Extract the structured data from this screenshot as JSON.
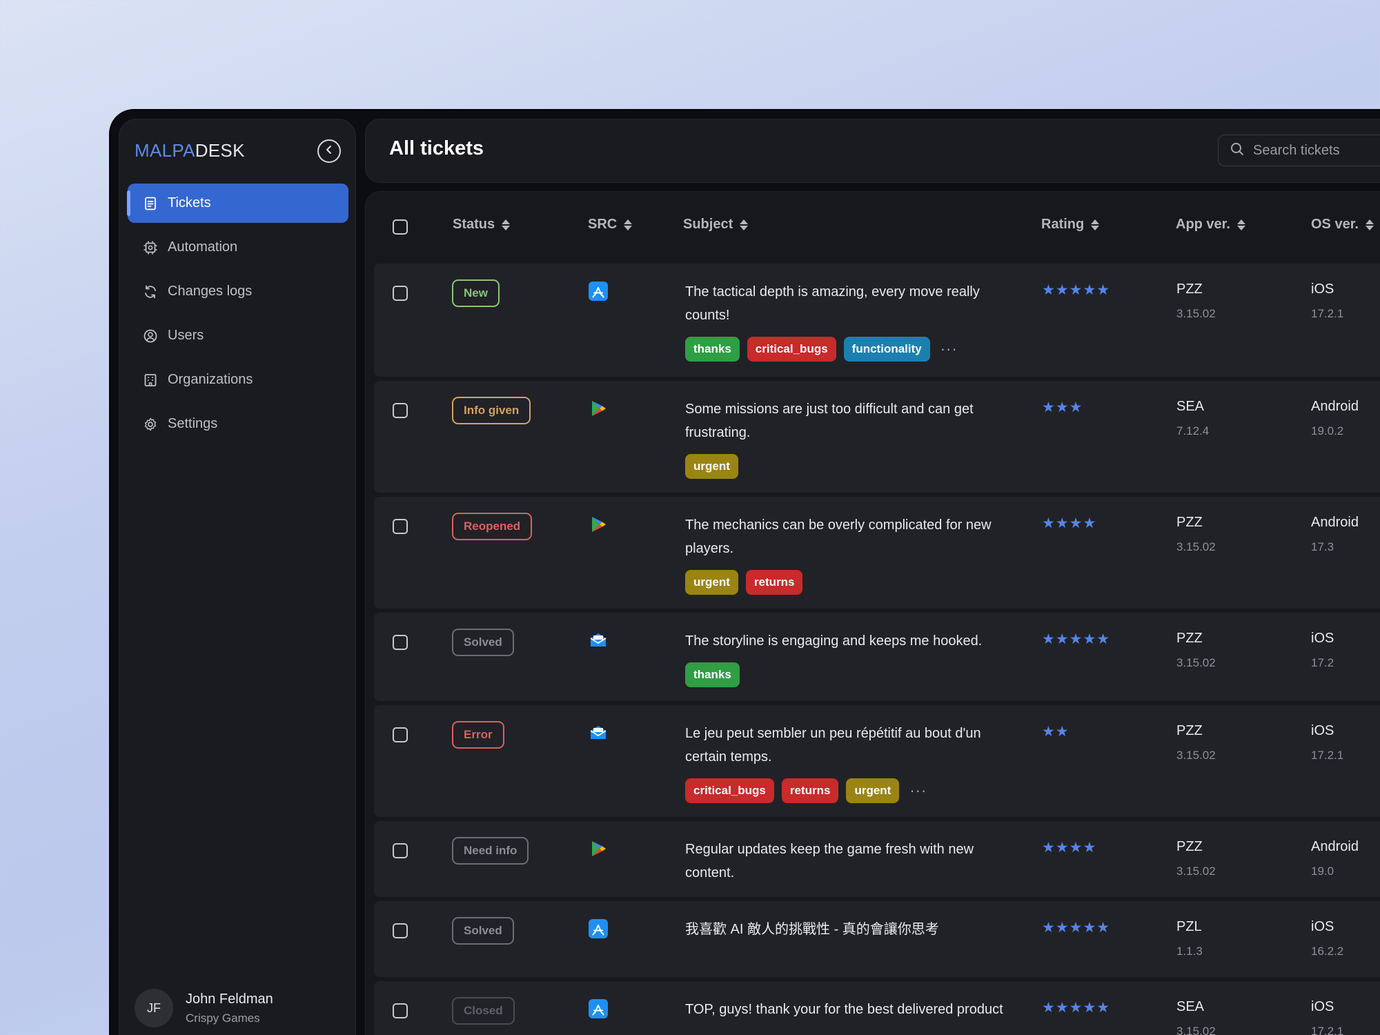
{
  "app": {
    "logo_prefix": "MALPA",
    "logo_suffix": "DESK",
    "collapse_icon": "chevron-left-icon"
  },
  "sidebar": {
    "items": [
      {
        "label": "Tickets",
        "icon": "ticket-icon",
        "active": true
      },
      {
        "label": "Automation",
        "icon": "automation-icon",
        "active": false
      },
      {
        "label": "Changes logs",
        "icon": "refresh-icon",
        "active": false
      },
      {
        "label": "Users",
        "icon": "user-circle-icon",
        "active": false
      },
      {
        "label": "Organizations",
        "icon": "building-icon",
        "active": false
      },
      {
        "label": "Settings",
        "icon": "gear-icon",
        "active": false
      }
    ],
    "user": {
      "initials": "JF",
      "name": "John Feldman",
      "org": "Crispy Games"
    }
  },
  "header": {
    "title": "All tickets",
    "search_placeholder": "Search tickets"
  },
  "table": {
    "columns": [
      "Status",
      "SRC",
      "Subject",
      "Rating",
      "App ver.",
      "OS ver."
    ],
    "rows": [
      {
        "status": "New",
        "src": "app-store-icon",
        "subject": "The tactical depth is amazing, every move really counts!",
        "tags": [
          "thanks",
          "critical_bugs",
          "functionality"
        ],
        "more": "···",
        "rating": "★★★★★",
        "app": "PZZ",
        "app_ver": "3.15.02",
        "os": "iOS",
        "os_ver": "17.2.1"
      },
      {
        "status": "Info given",
        "src": "google-play-icon",
        "subject": "Some missions are just too difficult and can get frustrating.",
        "tags": [
          "urgent"
        ],
        "rating": "★★★",
        "app": "SEA",
        "app_ver": "7.12.4",
        "os": "Android",
        "os_ver": "19.0.2"
      },
      {
        "status": "Reopened",
        "src": "google-play-icon",
        "subject": "The mechanics can be overly complicated for new players.",
        "tags": [
          "urgent",
          "returns"
        ],
        "rating": "★★★★",
        "app": "PZZ",
        "app_ver": "3.15.02",
        "os": "Android",
        "os_ver": "17.3"
      },
      {
        "status": "Solved",
        "src": "email-icon",
        "subject": "The storyline is engaging and keeps me hooked.",
        "tags": [
          "thanks"
        ],
        "rating": "★★★★★",
        "app": "PZZ",
        "app_ver": "3.15.02",
        "os": "iOS",
        "os_ver": "17.2"
      },
      {
        "status": "Error",
        "src": "email-icon",
        "subject": "Le jeu peut sembler un peu répétitif au bout d'un certain temps.",
        "tags": [
          "critical_bugs",
          "returns",
          "urgent"
        ],
        "more": "···",
        "rating": "★★",
        "app": "PZZ",
        "app_ver": "3.15.02",
        "os": "iOS",
        "os_ver": "17.2.1"
      },
      {
        "status": "Need info",
        "src": "google-play-icon",
        "subject": "Regular updates keep the game fresh with new content.",
        "tags": [],
        "rating": "★★★★",
        "app": "PZZ",
        "app_ver": "3.15.02",
        "os": "Android",
        "os_ver": "19.0"
      },
      {
        "status": "Solved",
        "src": "app-store-icon",
        "subject": "我喜歡 AI 敵人的挑戰性 - 真的會讓你思考",
        "tags": [],
        "rating": "★★★★★",
        "app": "PZL",
        "app_ver": "1.1.3",
        "os": "iOS",
        "os_ver": "16.2.2"
      },
      {
        "status": "Closed",
        "src": "app-store-icon",
        "subject": "TOP, guys! thank your for the best delivered product",
        "tags": [],
        "rating": "★★★★★",
        "app": "SEA",
        "app_ver": "3.15.02",
        "os": "iOS",
        "os_ver": "17.2.1"
      }
    ]
  },
  "colors": {
    "accent": "#3467d0",
    "star": "#5585e6",
    "background": "#17181c"
  }
}
